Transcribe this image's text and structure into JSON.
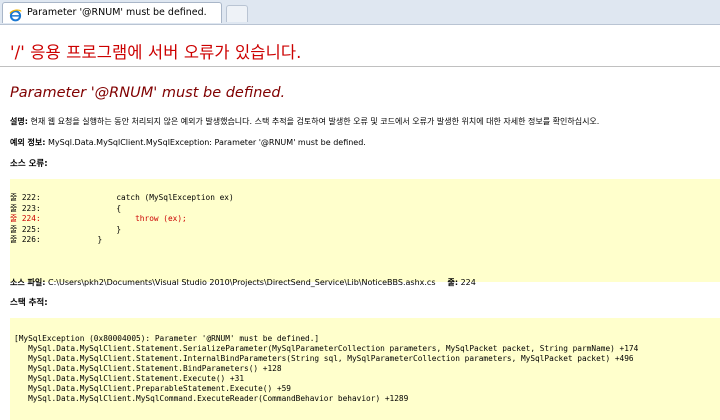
{
  "browser": {
    "tab_title": "Parameter '@RNUM' must be defined.",
    "tab_icon": "internet-explorer-icon"
  },
  "page": {
    "app_error_title": "'/' 응용 프로그램에 서버 오류가 있습니다.",
    "error_heading": "Parameter '@RNUM' must be defined.",
    "description_label": "설명:",
    "description_text": " 현재 웹 요청을 실행하는 동안 처리되지 않은 예외가 발생했습니다. 스택 추적을 검토하여 발생한 오류 및 코드에서 오류가 발생한 위치에 대한 자세한 정보를 확인하십시오.",
    "exception_label": "예외 정보:",
    "exception_text": " MySql.Data.MySqlClient.MySqlException: Parameter '@RNUM' must be defined.",
    "source_error_label": "소스 오류:",
    "source_lines": [
      {
        "ln": "줄 222:",
        "code": "            catch (MySqlException ex)",
        "error": false
      },
      {
        "ln": "줄 223:",
        "code": "            {",
        "error": false
      },
      {
        "ln": "줄 224:",
        "code": "                throw (ex);",
        "error": true
      },
      {
        "ln": "줄 225:",
        "code": "            }",
        "error": false
      },
      {
        "ln": "줄 226:",
        "code": "        }",
        "error": false
      }
    ],
    "source_file_label": "소스 파일:",
    "source_file_path": " C:\\Users\\pkh2\\Documents\\Visual Studio 2010\\Projects\\DirectSend_Service\\Lib\\NoticeBBS.ashx.cs",
    "line_label": "줄:",
    "line_number": " 224",
    "stack_trace_label": "스택 추적:",
    "stack_trace": "[MySqlException (0x80004005): Parameter '@RNUM' must be defined.]\n   MySql.Data.MySqlClient.Statement.SerializeParameter(MySqlParameterCollection parameters, MySqlPacket packet, String parmName) +174\n   MySql.Data.MySqlClient.Statement.InternalBindParameters(String sql, MySqlParameterCollection parameters, MySqlPacket packet) +496\n   MySql.Data.MySqlClient.Statement.BindParameters() +128\n   MySql.Data.MySqlClient.Statement.Execute() +31\n   MySql.Data.MySqlClient.PreparableStatement.Execute() +59\n   MySql.Data.MySqlClient.MySqlCommand.ExecuteReader(CommandBehavior behavior) +1289"
  },
  "colors": {
    "title_red": "#cc0000",
    "heading_maroon": "#800000",
    "code_background": "#ffffcc"
  }
}
